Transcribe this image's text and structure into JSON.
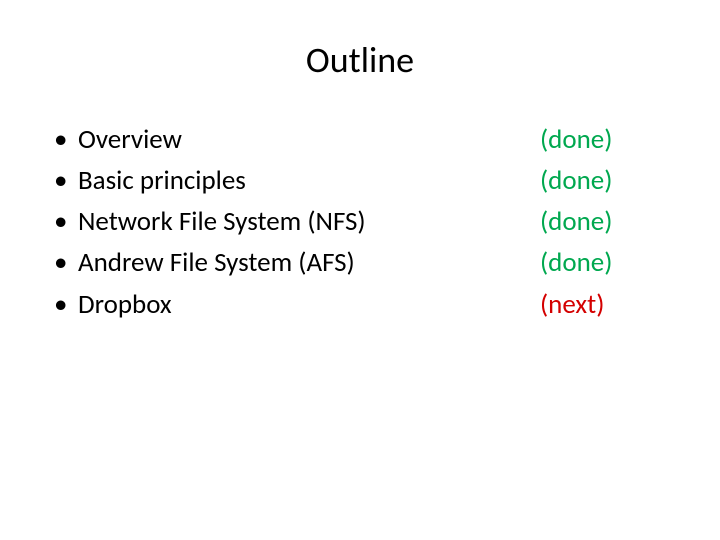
{
  "title": "Outline",
  "items": [
    {
      "label": "Overview",
      "status": "(done)",
      "statusClass": "status-done"
    },
    {
      "label": "Basic principles",
      "status": "(done)",
      "statusClass": "status-done"
    },
    {
      "label": "Network File System (NFS)",
      "status": "(done)",
      "statusClass": "status-done"
    },
    {
      "label": "Andrew File System (AFS)",
      "status": "(done)",
      "statusClass": "status-done"
    },
    {
      "label": "Dropbox",
      "status": "(next)",
      "statusClass": "status-next"
    }
  ]
}
